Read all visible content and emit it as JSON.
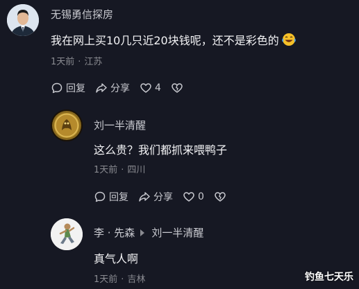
{
  "comments": [
    {
      "username": "无锡勇信探房",
      "text": "我在网上买10几只近20块钱呢，还不是彩色的",
      "time": "1天前",
      "location": "江苏",
      "reply_label": "回复",
      "share_label": "分享",
      "like_count": "4"
    },
    {
      "username": "刘一半清醒",
      "text": "这么贵？我们都抓来喂鸭子",
      "time": "1天前",
      "location": "四川",
      "reply_label": "回复",
      "share_label": "分享",
      "like_count": "0"
    },
    {
      "username": "李 · 先森",
      "reply_to": "刘一半清醒",
      "text": "真气人啊",
      "time": "1天前",
      "location": "吉林"
    }
  ],
  "watermark": "钓鱼七天乐",
  "colors": {
    "background": "#161823",
    "username": "#c9cad0",
    "text": "#f3f3f5",
    "meta": "#8a8b91"
  },
  "icons": [
    "comment-icon",
    "share-icon",
    "heart-icon",
    "dislike-icon",
    "laughing-emoji-icon"
  ]
}
